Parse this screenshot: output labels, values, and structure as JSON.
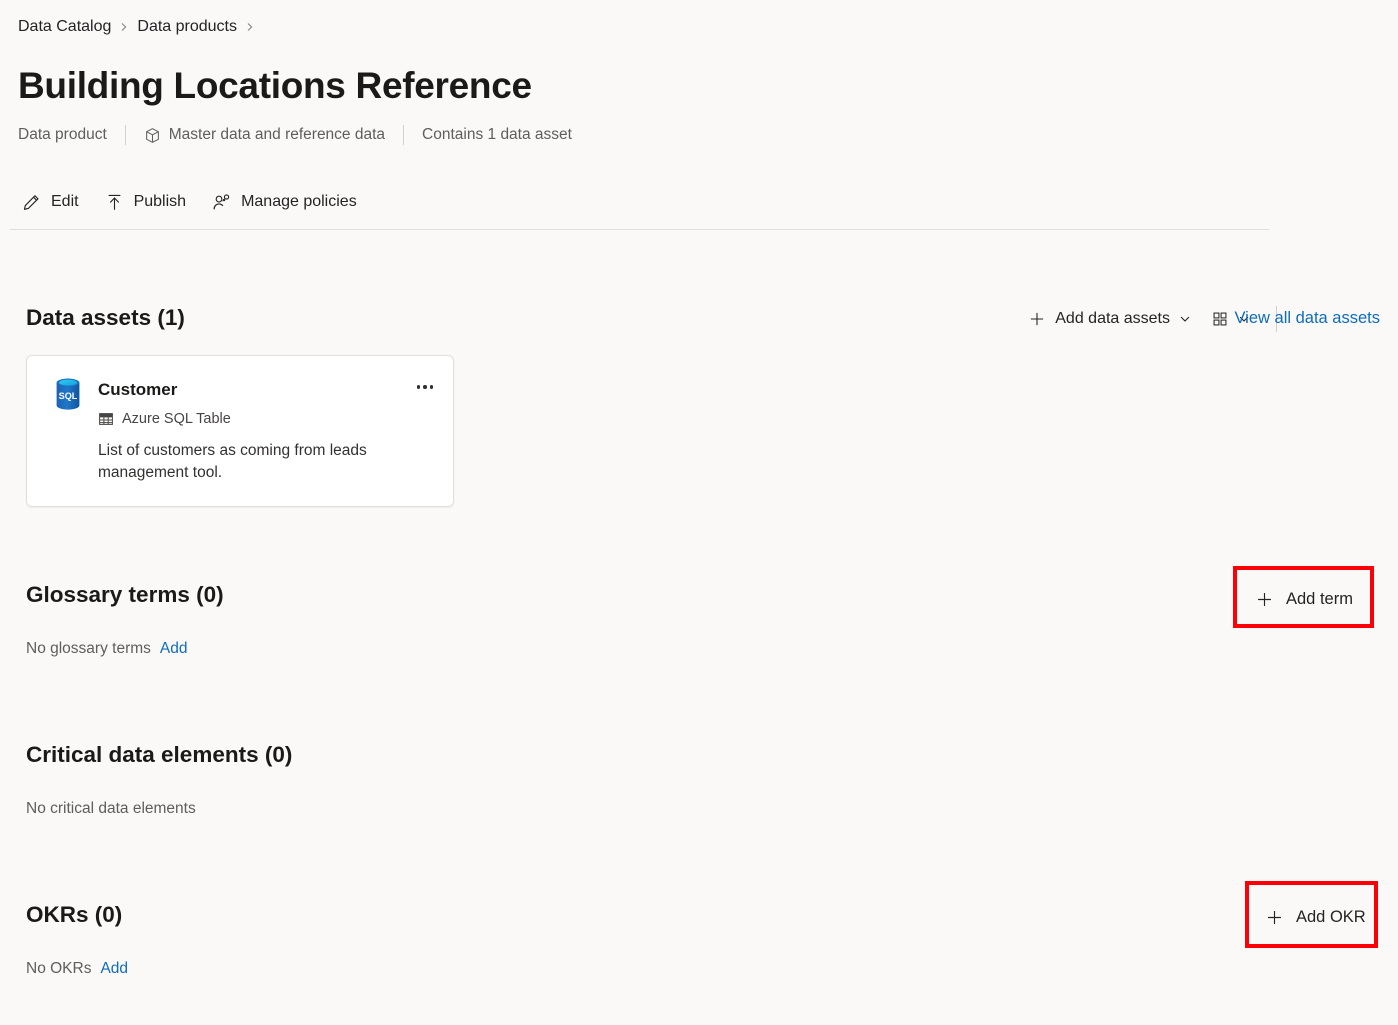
{
  "breadcrumb": {
    "items": [
      {
        "label": "Data Catalog"
      },
      {
        "label": "Data products"
      }
    ]
  },
  "header": {
    "title": "Building Locations Reference",
    "meta": {
      "kind": "Data product",
      "domain": "Master data and reference data",
      "domain_icon": "cube-icon",
      "contains": "Contains 1 data asset"
    }
  },
  "commandbar": {
    "edit": {
      "label": "Edit",
      "icon": "pencil-icon"
    },
    "publish": {
      "label": "Publish",
      "icon": "upload-arrow-icon"
    },
    "manage_policies": {
      "label": "Manage policies",
      "icon": "person-key-icon"
    }
  },
  "data_assets": {
    "heading": "Data assets (1)",
    "toolbar": {
      "add_label": "Add data assets",
      "add_icon": "plus-icon",
      "view_toggle_icon": "grid-view-icon",
      "chevron_icon": "chevron-down-icon",
      "view_all_label": "View all data assets"
    },
    "cards": [
      {
        "title": "Customer",
        "icon": "azure-sql-database-icon",
        "type": "Azure SQL Table",
        "type_icon": "table-icon",
        "description": "List of customers as coming from leads management tool.",
        "more_icon": "more-options-icon"
      }
    ]
  },
  "glossary_terms": {
    "heading": "Glossary terms (0)",
    "empty_text": "No glossary terms",
    "add_link": "Add",
    "action": {
      "label": "Add term",
      "icon": "plus-icon",
      "highlighted": true
    }
  },
  "critical_data_elements": {
    "heading": "Critical data elements (0)",
    "empty_text": "No critical data elements"
  },
  "okrs": {
    "heading": "OKRs (0)",
    "empty_text": "No OKRs",
    "add_link": "Add",
    "action": {
      "label": "Add OKR",
      "icon": "plus-icon",
      "highlighted": true
    }
  },
  "colors": {
    "page_background": "#faf9f8",
    "card_background": "#ffffff",
    "link": "#0f6cbd",
    "highlight_border": "#fb0007",
    "text_primary": "#1b1a19",
    "text_secondary": "#605e5c",
    "divider": "#e1dfdd"
  }
}
